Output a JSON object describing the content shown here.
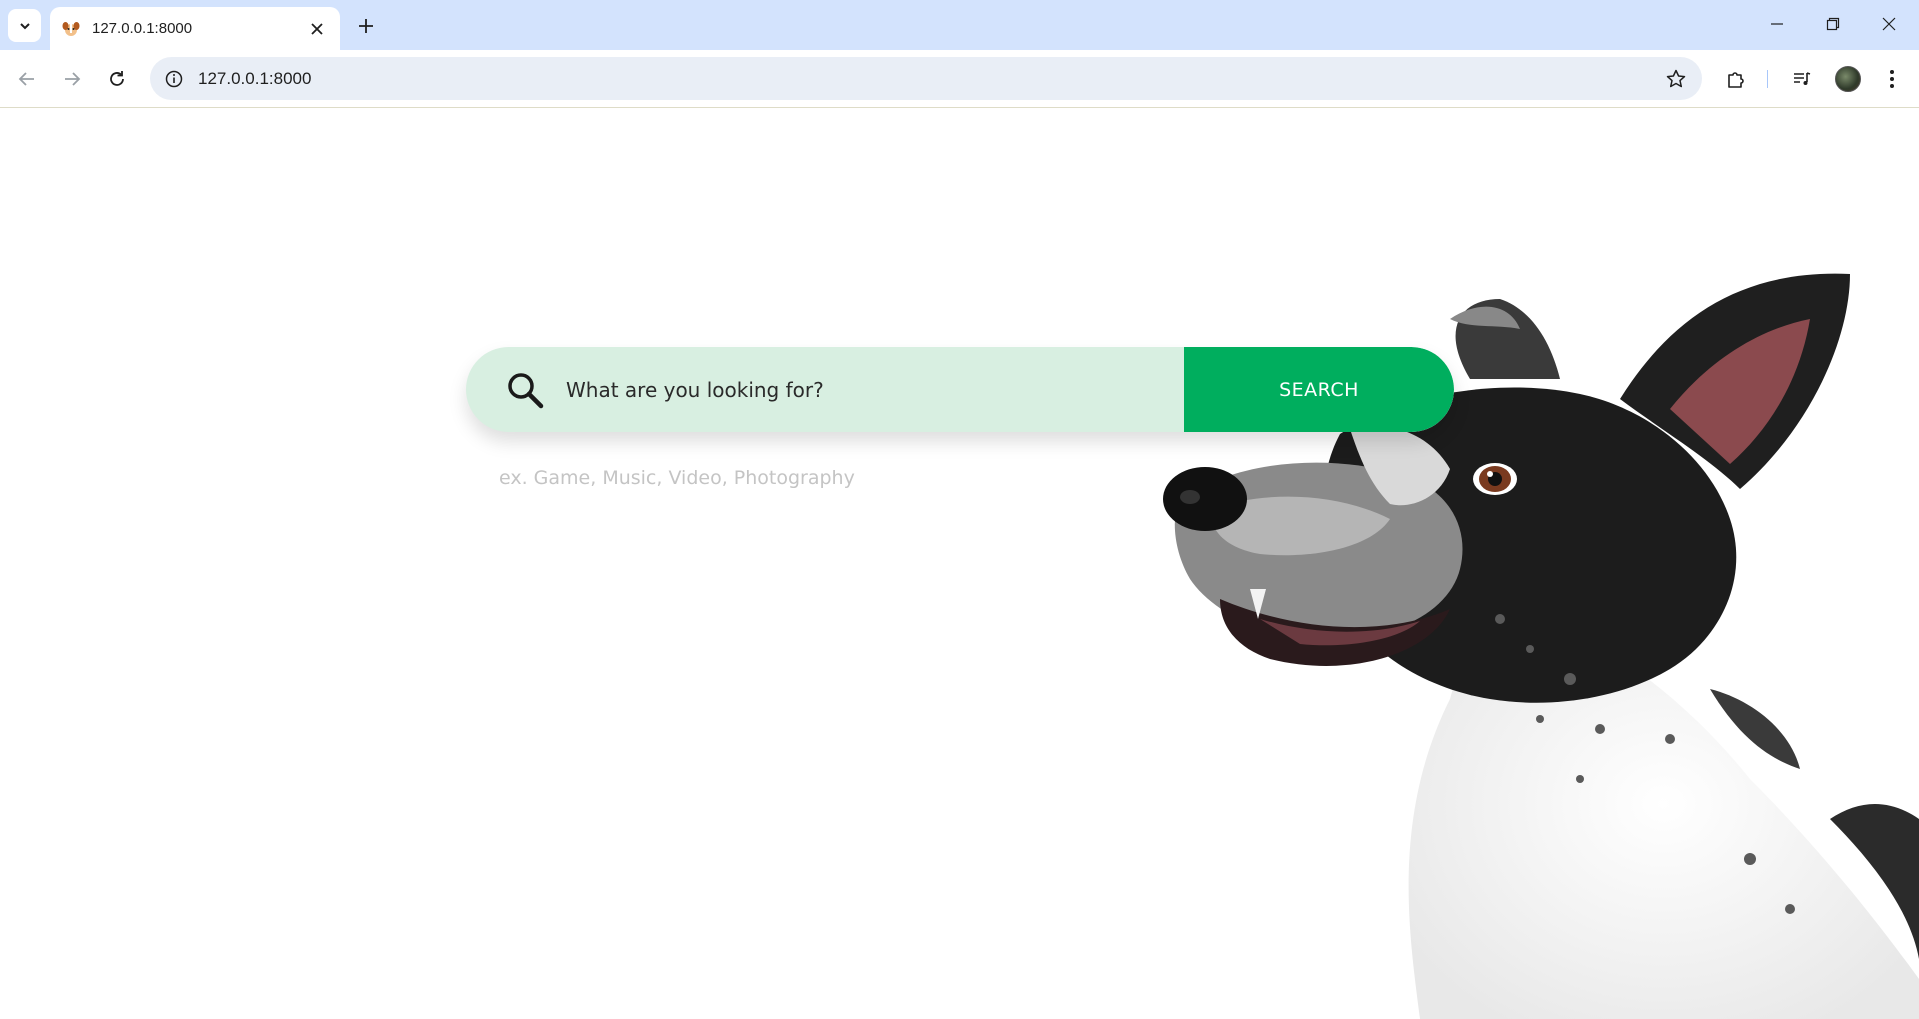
{
  "browser": {
    "tab_title": "127.0.0.1:8000",
    "url": "127.0.0.1:8000",
    "accent_color": "#d3e3fd"
  },
  "search": {
    "placeholder": "What are you looking for?",
    "button_label": "SEARCH",
    "hint": "ex. Game, Music, Video, Photography",
    "bar_color": "#d8efe1",
    "button_color": "#00ae5e"
  }
}
